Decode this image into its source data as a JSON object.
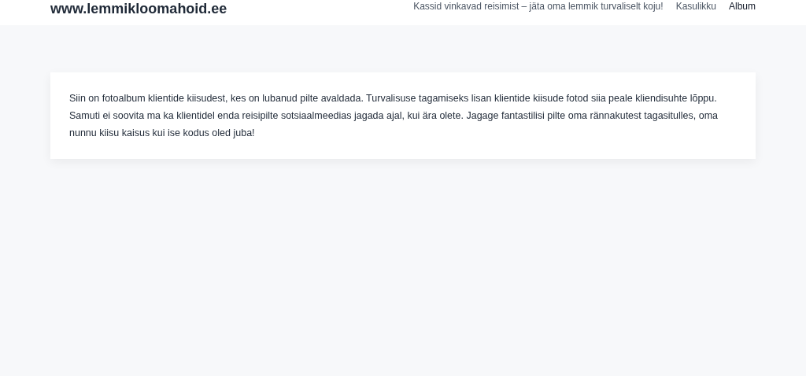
{
  "header": {
    "site_title": "www.lemmikloomahoid.ee",
    "nav": [
      {
        "label": "Kassid vinkavad reisimist – jäta oma lemmik turvaliselt koju!",
        "selected": false
      },
      {
        "label": "Kasulikku",
        "selected": false
      },
      {
        "label": "Album",
        "selected": true
      }
    ]
  },
  "content": {
    "text": "Siin on fotoalbum klientide kiisudest, kes on lubanud pilte avaldada. Turvalisuse tagamiseks lisan klientide kiisude fotod siia peale kliendisuhte lõppu. Samuti ei soovita ma ka klientidel enda reisipilte sotsiaalmeedias jagada ajal, kui ära olete. Jagage fantastilisi pilte oma rännakutest tagasitulles, oma nunnu kiisu kaisus kui ise kodus oled juba!"
  }
}
